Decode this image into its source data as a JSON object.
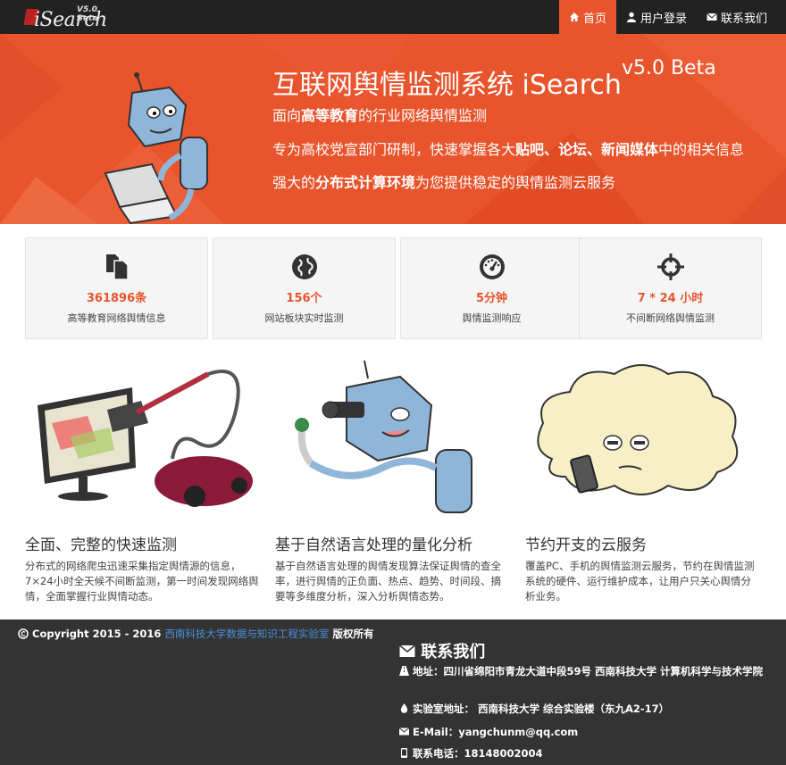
{
  "brand": {
    "name": "iSearch",
    "version": "V5.0 Beta"
  },
  "nav": [
    {
      "label": "首页",
      "icon": "home-icon"
    },
    {
      "label": "用户登录",
      "icon": "user-icon"
    },
    {
      "label": "联系我们",
      "icon": "envelope-icon"
    }
  ],
  "hero": {
    "title": "互联网舆情监测系统 iSearch",
    "version": "v5.0 Beta",
    "line1": {
      "pre": "面向",
      "bold": "高等教育",
      "post": "的行业网络舆情监测"
    },
    "line2": {
      "pre": "专为高校党宣部门研制，快速掌握各大",
      "bold1": "贴吧、论坛、新闻媒体",
      "post": "中的相关信息"
    },
    "line3": {
      "pre": "强大的",
      "bold": "分布式计算环境",
      "post": "为您提供稳定的舆情监测云服务"
    }
  },
  "stats": [
    {
      "value": "361896条",
      "label": "高等教育网络舆情信息",
      "icon": "documents-icon"
    },
    {
      "value": "156个",
      "label": "网站板块实时监测",
      "icon": "globe-icon"
    },
    {
      "value": "5分钟",
      "label": "舆情监测响应",
      "icon": "dashboard-icon"
    },
    {
      "value": "7 * 24 小时",
      "label": "不间断网络舆情监测",
      "icon": "crosshair-icon"
    }
  ],
  "features": [
    {
      "title": "全面、完整的快速监测",
      "text": "分布式的网络爬虫迅速采集指定舆情源的信息，7×24小时全天候不间断监测，第一时间发现网络舆情，全面掌握行业舆情动态。",
      "image": "vacuum-monitor-illustration"
    },
    {
      "title": "基于自然语言处理的量化分析",
      "text": "基于自然语言处理的舆情发现算法保证舆情的查全率，进行舆情的正负面、热点、趋势、时间段、摘要等多维度分析，深入分析舆情态势。",
      "image": "robot-telescope-illustration"
    },
    {
      "title": "节约开支的云服务",
      "text": "覆盖PC、手机的舆情监测云服务，节约在舆情监测系统的硬件、运行维护成本，让用户只关心舆情分析业务。",
      "image": "cloud-phone-illustration"
    }
  ],
  "footer": {
    "copyright_pre": "Copyright 2015 - 2016",
    "copyright_link": "西南科技大学数据与知识工程实验室",
    "copyright_post": "版权所有",
    "contact_title": "联系我们",
    "address": "地址：四川省绵阳市青龙大道中段59号 西南科技大学 计算机科学与技术学院",
    "lab_address": "实验室地址： 西南科技大学 综合实验楼（东九A2-17）",
    "email": "E-Mail：yangchunm@qq.com",
    "phone": "联系电话：18148002004"
  },
  "colors": {
    "accent": "#e8542c",
    "navbar": "#222222",
    "footer": "#333333",
    "link": "#4a90d9"
  }
}
